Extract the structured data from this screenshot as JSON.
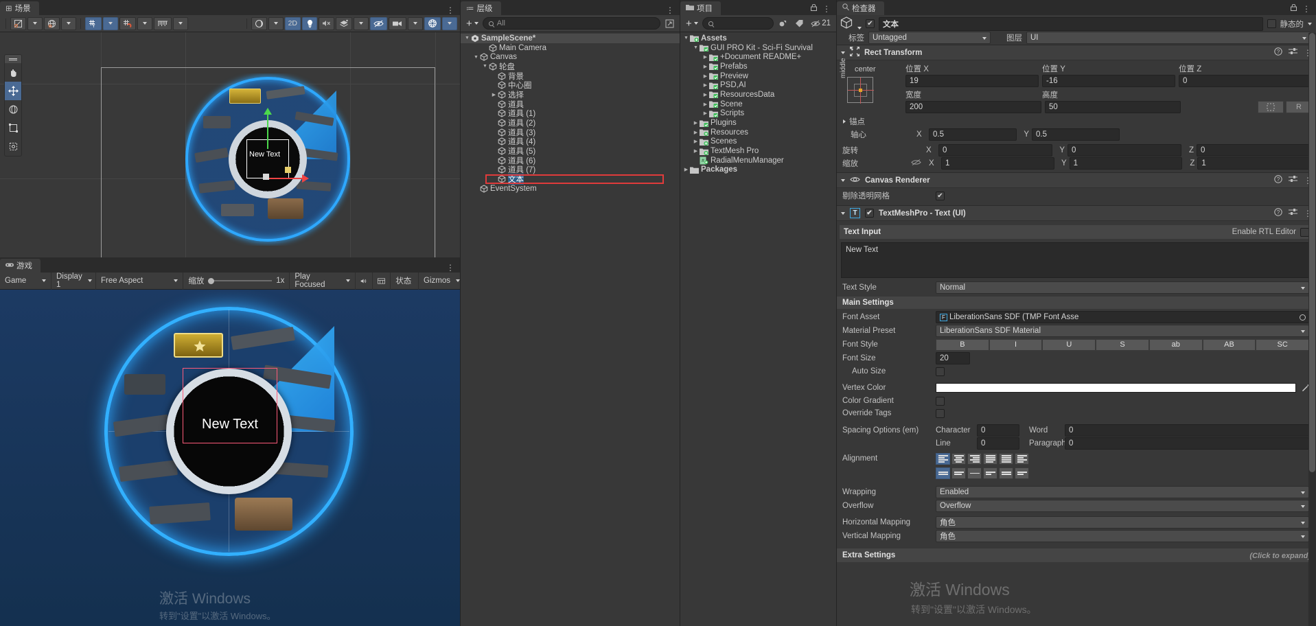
{
  "scene_panel": {
    "tab_label": "场景",
    "toolbar": {
      "pivot_label": "",
      "two_d_label": "2D",
      "gizmos_count": ""
    },
    "tools": [
      "hand-tool",
      "move-tool",
      "rotate-tool",
      "rect-tool",
      "transform-tool"
    ]
  },
  "game_panel": {
    "tab_label": "游戏",
    "display_select": "Display 1",
    "aspect_select": "Free Aspect",
    "scale_label": "缩放",
    "scale_value": "1x",
    "play_mode_select": "Play Focused",
    "game_select": "Game",
    "stats_label": "状态",
    "gizmos_label": "Gizmos",
    "center_text": "New Text"
  },
  "hierarchy": {
    "tab_label": "层级",
    "search_placeholder": "All",
    "add_label": "+",
    "items": [
      {
        "label": "SampleScene*",
        "depth": 0,
        "type": "scene",
        "tri": "down"
      },
      {
        "label": "Main Camera",
        "depth": 2,
        "type": "go",
        "tri": ""
      },
      {
        "label": "Canvas",
        "depth": 1,
        "type": "go",
        "tri": "down"
      },
      {
        "label": "轮盘",
        "depth": 2,
        "type": "go",
        "tri": "down"
      },
      {
        "label": "背景",
        "depth": 3,
        "type": "go",
        "tri": ""
      },
      {
        "label": "中心圈",
        "depth": 3,
        "type": "go",
        "tri": ""
      },
      {
        "label": "选择",
        "depth": 3,
        "type": "go",
        "tri": "right"
      },
      {
        "label": "道具",
        "depth": 3,
        "type": "go",
        "tri": ""
      },
      {
        "label": "道具 (1)",
        "depth": 3,
        "type": "go",
        "tri": ""
      },
      {
        "label": "道具 (2)",
        "depth": 3,
        "type": "go",
        "tri": ""
      },
      {
        "label": "道具 (3)",
        "depth": 3,
        "type": "go",
        "tri": ""
      },
      {
        "label": "道具 (4)",
        "depth": 3,
        "type": "go",
        "tri": ""
      },
      {
        "label": "道具 (5)",
        "depth": 3,
        "type": "go",
        "tri": ""
      },
      {
        "label": "道具 (6)",
        "depth": 3,
        "type": "go",
        "tri": ""
      },
      {
        "label": "道具 (7)",
        "depth": 3,
        "type": "go",
        "tri": ""
      },
      {
        "label": "文本",
        "depth": 3,
        "type": "go",
        "tri": "",
        "selected": true
      },
      {
        "label": "EventSystem",
        "depth": 1,
        "type": "go",
        "tri": ""
      }
    ]
  },
  "project": {
    "tab_label": "项目",
    "search_placeholder": "",
    "hidden_count": "21",
    "items": [
      {
        "label": "Assets",
        "depth": 0,
        "tri": "down",
        "icon": "folder-plus",
        "bold": true
      },
      {
        "label": "GUI PRO Kit - Sci-Fi Survival",
        "depth": 1,
        "tri": "down",
        "icon": "folder-check"
      },
      {
        "label": "+Document README+",
        "depth": 2,
        "tri": "right",
        "icon": "folder-check"
      },
      {
        "label": "Prefabs",
        "depth": 2,
        "tri": "right",
        "icon": "folder-check"
      },
      {
        "label": "Preview",
        "depth": 2,
        "tri": "right",
        "icon": "folder-check"
      },
      {
        "label": "PSD,AI",
        "depth": 2,
        "tri": "right",
        "icon": "folder-check"
      },
      {
        "label": "ResourcesData",
        "depth": 2,
        "tri": "right",
        "icon": "folder-check"
      },
      {
        "label": "Scene",
        "depth": 2,
        "tri": "right",
        "icon": "folder-check"
      },
      {
        "label": "Scripts",
        "depth": 2,
        "tri": "right",
        "icon": "folder-check"
      },
      {
        "label": "Plugins",
        "depth": 1,
        "tri": "right",
        "icon": "folder-check"
      },
      {
        "label": "Resources",
        "depth": 1,
        "tri": "right",
        "icon": "folder-plus"
      },
      {
        "label": "Scenes",
        "depth": 1,
        "tri": "right",
        "icon": "folder-plus"
      },
      {
        "label": "TextMesh Pro",
        "depth": 1,
        "tri": "right",
        "icon": "folder-plus"
      },
      {
        "label": "RadialMenuManager",
        "depth": 1,
        "tri": "",
        "icon": "script"
      },
      {
        "label": "Packages",
        "depth": 0,
        "tri": "right",
        "icon": "folder",
        "bold": true
      }
    ]
  },
  "inspector": {
    "tab_label": "检查器",
    "object_name": "文本",
    "static_label": "静态的",
    "tag_label": "标签",
    "tag_value": "Untagged",
    "layer_label": "图层",
    "layer_value": "UI",
    "rect_transform": {
      "title": "Rect Transform",
      "anchor_preset_top": "center",
      "anchor_preset_side": "middle",
      "pos_x_label": "位置 X",
      "pos_x": "19",
      "pos_y_label": "位置 Y",
      "pos_y": "-16",
      "pos_z_label": "位置 Z",
      "pos_z": "0",
      "width_label": "宽度",
      "width": "200",
      "height_label": "高度",
      "height": "50",
      "blueprint_label": "R",
      "anchors_label": "锚点",
      "pivot_label": "轴心",
      "pivot_x": "0.5",
      "pivot_y": "0.5",
      "rotation_label": "旋转",
      "rot_x": "0",
      "rot_y": "0",
      "rot_z": "0",
      "scale_label": "缩放",
      "scale_x": "1",
      "scale_y": "1",
      "scale_z": "1"
    },
    "canvas_renderer": {
      "title": "Canvas Renderer",
      "cull_label": "剔除透明网格"
    },
    "tmp": {
      "title": "TextMeshPro - Text (UI)",
      "text_input_label": "Text Input",
      "rtl_label": "Enable RTL Editor",
      "text_value": "New Text",
      "text_style_label": "Text Style",
      "text_style_value": "Normal",
      "main_settings_label": "Main Settings",
      "font_asset_label": "Font Asset",
      "font_asset_value": "LiberationSans SDF (TMP Font Asse",
      "material_preset_label": "Material Preset",
      "material_preset_value": "LiberationSans SDF Material",
      "font_style_label": "Font Style",
      "font_style_buttons": [
        "B",
        "I",
        "U",
        "S",
        "ab",
        "AB",
        "SC"
      ],
      "font_size_label": "Font Size",
      "font_size_value": "20",
      "auto_size_label": "Auto Size",
      "vertex_color_label": "Vertex Color",
      "vertex_color_hex": "#ffffff",
      "color_gradient_label": "Color Gradient",
      "override_tags_label": "Override Tags",
      "spacing_label": "Spacing Options (em)",
      "character_label": "Character",
      "character_value": "0",
      "word_label": "Word",
      "word_value": "0",
      "line_label": "Line",
      "line_value": "0",
      "paragraph_label": "Paragraph",
      "paragraph_value": "0",
      "alignment_label": "Alignment",
      "wrapping_label": "Wrapping",
      "wrapping_value": "Enabled",
      "overflow_label": "Overflow",
      "overflow_value": "Overflow",
      "h_mapping_label": "Horizontal Mapping",
      "h_mapping_value": "角色",
      "v_mapping_label": "Vertical Mapping",
      "v_mapping_value": "角色",
      "extra_settings_label": "Extra Settings",
      "click_expand_label": "(Click to expand)"
    }
  },
  "watermark": {
    "line1": "激活 Windows",
    "line2": "转到\"设置\"以激活 Windows。"
  },
  "colors": {
    "accent": "#4a6a94",
    "selection": "#2c5d87",
    "highlight_red": "#e03b3b"
  }
}
